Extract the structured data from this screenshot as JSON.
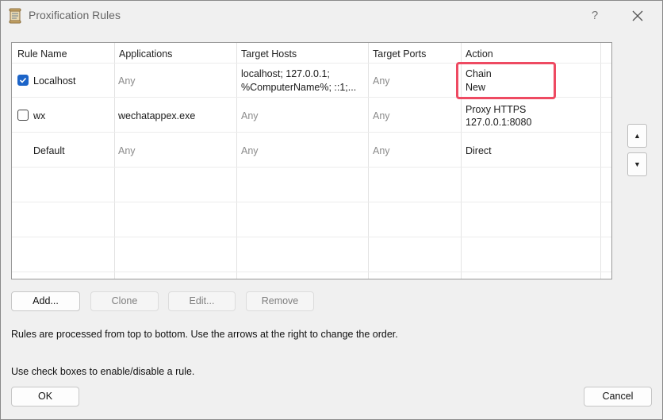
{
  "window": {
    "title": "Proxification Rules",
    "help_label": "?",
    "close_label": "✕"
  },
  "table": {
    "headers": [
      "Rule Name",
      "Applications",
      "Target Hosts",
      "Target Ports",
      "Action"
    ],
    "rows": [
      {
        "checked": true,
        "name": "Localhost",
        "applications": "Any",
        "hosts_line1": "localhost; 127.0.0.1;",
        "hosts_line2": "%ComputerName%; ::1;...",
        "ports": "Any",
        "action_line1": "Chain",
        "action_line2": "New"
      },
      {
        "checked": false,
        "name": "wx",
        "applications": "wechatappex.exe",
        "hosts_line1": "Any",
        "ports": "Any",
        "action_line1": "Proxy HTTPS",
        "action_line2": "127.0.0.1:8080"
      },
      {
        "name": "Default",
        "applications": "Any",
        "hosts_line1": "Any",
        "ports": "Any",
        "action_line1": "Direct"
      }
    ]
  },
  "buttons": {
    "add": "Add...",
    "clone": "Clone",
    "edit": "Edit...",
    "remove": "Remove",
    "ok": "OK",
    "cancel": "Cancel"
  },
  "notes": {
    "line1": "Rules are processed from top to bottom. Use the arrows at the right to change the order.",
    "line2": "Use check boxes to enable/disable a rule."
  },
  "arrows": {
    "up": "▲",
    "down": "▼"
  },
  "colors": {
    "highlight": "#ee4a62",
    "checkbox": "#1c64c8"
  }
}
